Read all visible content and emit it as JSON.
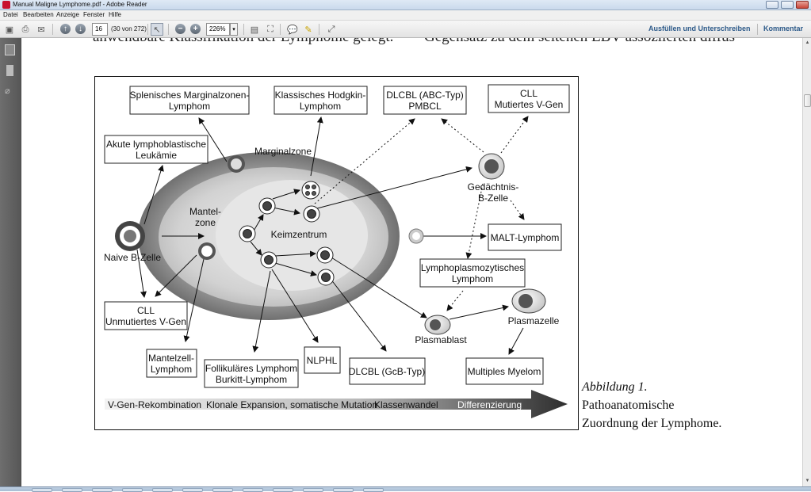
{
  "window": {
    "title": "Manual Maligne Lymphome.pdf - Adobe Reader"
  },
  "menu": [
    "Datei",
    "Bearbeiten",
    "Anzeige",
    "Fenster",
    "Hilfe"
  ],
  "toolbar": {
    "page_number": "16",
    "page_count": "(30 von 272)",
    "zoom": "226%",
    "fill_sign": "Ausfüllen und Unterschreiben",
    "comment": "Kommentar"
  },
  "document": {
    "heading_left": "anwendbare Klassifikation der Lymphome gelegt.",
    "heading_right": "Gegensatz zu dem seltenen EBV-assoziierten diffus",
    "caption_line1": "Abbildung 1.",
    "caption_line2": "Pathoanatomische",
    "caption_line3": "Zuordnung der Lymphome."
  },
  "figure": {
    "boxes": {
      "splenisch": [
        "Splenisches Marginalzonen-",
        "Lymphom"
      ],
      "hodgkin": [
        "Klassisches Hodgkin-",
        "Lymphom"
      ],
      "dlbcl_abc": [
        "DLCBL (ABC-Typ)",
        "PMBCL"
      ],
      "cll_mut": [
        "CLL",
        "Mutiertes V-Gen"
      ],
      "akute": [
        "Akute lymphoblastische",
        "Leukämie"
      ],
      "malt": [
        "MALT-Lymphom"
      ],
      "lympho": [
        "Lymphoplasmozytisches",
        "Lymphom"
      ],
      "cll_unmut": [
        "CLL",
        "Unmutiertes V-Gen"
      ],
      "mantelzell": [
        "Mantelzell-",
        "Lymphom"
      ],
      "follikulaer": [
        "Follikuläres Lymphom",
        "Burkitt-Lymphom"
      ],
      "nlphl": [
        "NLPHL"
      ],
      "dlbcl_gcb": [
        "DLCBL (GcB-Typ)"
      ],
      "myelom": [
        "Multiples Myelom"
      ]
    },
    "labels": {
      "marginalzone": "Marginalzone",
      "mantelzone": [
        "Mantel-",
        "zone"
      ],
      "keimzentrum": "Keimzentrum",
      "naive": "Naive B-Zelle",
      "gedaechtnis": [
        "Gedächtnis-",
        "B-Zelle"
      ],
      "plasmablast": "Plasmablast",
      "plasmazelle": "Plasmazelle"
    },
    "bottom_bar": {
      "vgen": "V-Gen-Rekombination",
      "klonal": "Klonale Expansion, somatische Mutation",
      "klassen": "Klassenwandel",
      "diff": "Differenzierung"
    }
  }
}
